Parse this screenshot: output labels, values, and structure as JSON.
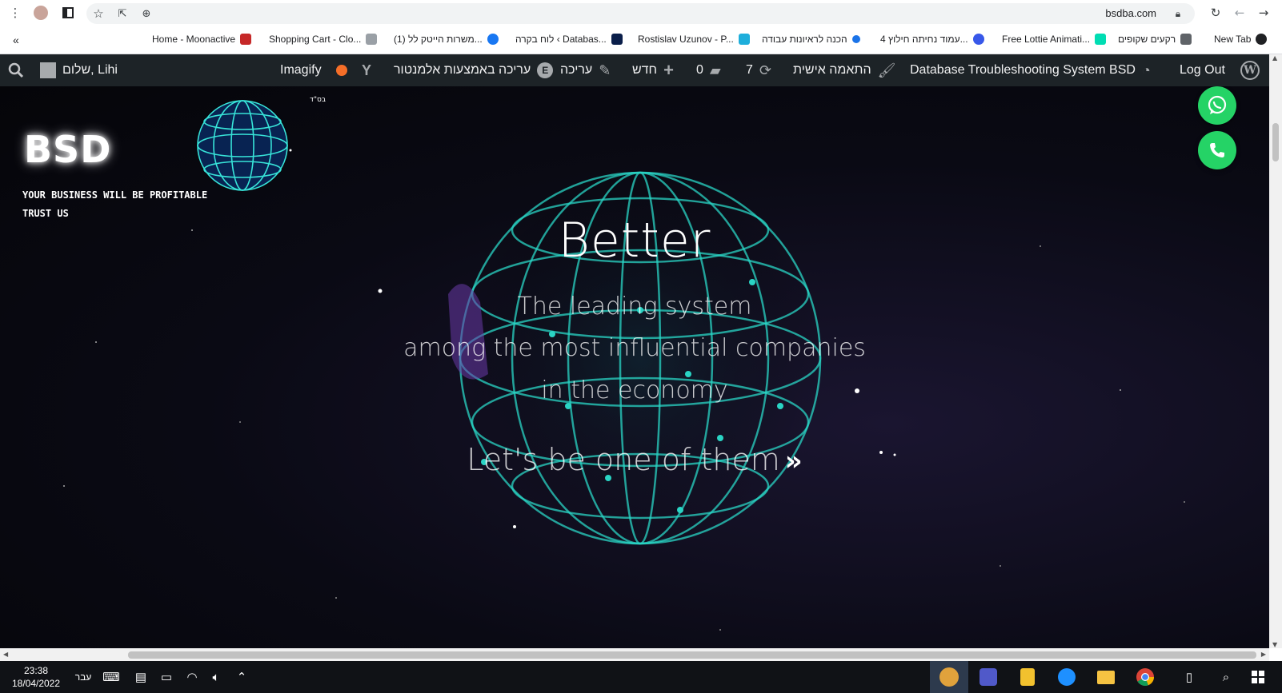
{
  "browser": {
    "url": "bsdba.com",
    "bookmarks": [
      {
        "label": "New Tab",
        "color": "#202124"
      },
      {
        "label": "רקעים שקופים",
        "color": "#5f6368"
      },
      {
        "label": "Free Lottie Animati...",
        "color": "#00ddb3"
      },
      {
        "label": "עמוד נחיתה חילוץ 4...",
        "color": "#3858e9"
      },
      {
        "label": "הכנה לראיונות עבודה",
        "color": "#1a73e8"
      },
      {
        "label": "Rostislav Uzunov - P...",
        "color": "#1eaedb"
      },
      {
        "label": "לוח בקרה ‹ Databas...",
        "color": "#0a1e4a"
      },
      {
        "label": "(1) משרות הייטק לל...",
        "color": "#1877f2"
      },
      {
        "label": "Shopping Cart - Clo...",
        "color": "#9aa0a6"
      },
      {
        "label": "Home - Moonactive",
        "color": "#c62828"
      }
    ]
  },
  "admin_bar": {
    "logout": "Log Out",
    "site_name": "Database Troubleshooting System BSD",
    "customize": "התאמה אישית",
    "updates_count": "7",
    "comments_count": "0",
    "new": "חדש",
    "edit": "עריכה",
    "elementor_edit": "עריכה באמצעות אלמנטור",
    "imagify": "Imagify",
    "greeting": "שלום, Lihi"
  },
  "hero": {
    "title": "Better",
    "sub_line1": "The leading system",
    "sub_line2": "among the most influential companies",
    "sub_line3": "in the economy",
    "cta": "Let's be one of them",
    "cta_arrow": "»"
  },
  "brand": {
    "logo": "BSD",
    "tagline1": "YOUR BUSINESS WILL BE PROFITABLE",
    "tagline2": "TRUST US",
    "bsd_hebrew": "בס\"ד"
  },
  "taskbar": {
    "time": "23:38",
    "date": "18/04/2022",
    "language": "עבר"
  },
  "colors": {
    "wp_bar": "#1d2327",
    "whatsapp_green": "#25d366",
    "globe_teal": "#2ad4c4"
  }
}
